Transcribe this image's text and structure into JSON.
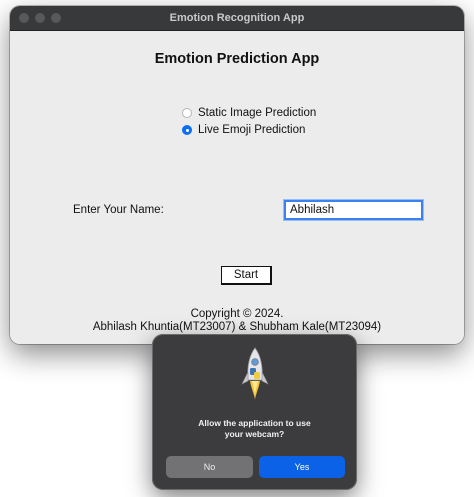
{
  "window": {
    "title": "Emotion Recognition App"
  },
  "app": {
    "heading": "Emotion Prediction App",
    "options": [
      {
        "label": "Static Image Prediction",
        "selected": false
      },
      {
        "label": "Live Emoji Prediction",
        "selected": true
      }
    ],
    "name_label": "Enter Your Name:",
    "name_value": "Abhilash",
    "start_label": "Start",
    "copyright_line1": "Copyright © 2024.",
    "copyright_line2": "Abhilash Khuntia(MT23007) & Shubham Kale(MT23094)"
  },
  "dialog": {
    "icon": "python-launcher-rocket-icon",
    "message_line1": "Allow the application to use",
    "message_line2": "your webcam?",
    "no_label": "No",
    "yes_label": "Yes"
  },
  "colors": {
    "accent": "#0b62e6",
    "radio_selected": "#0a6ff3",
    "titlebar": "#38393b",
    "window_bg": "#ececec",
    "dialog_bg": "#3c3b3d"
  }
}
